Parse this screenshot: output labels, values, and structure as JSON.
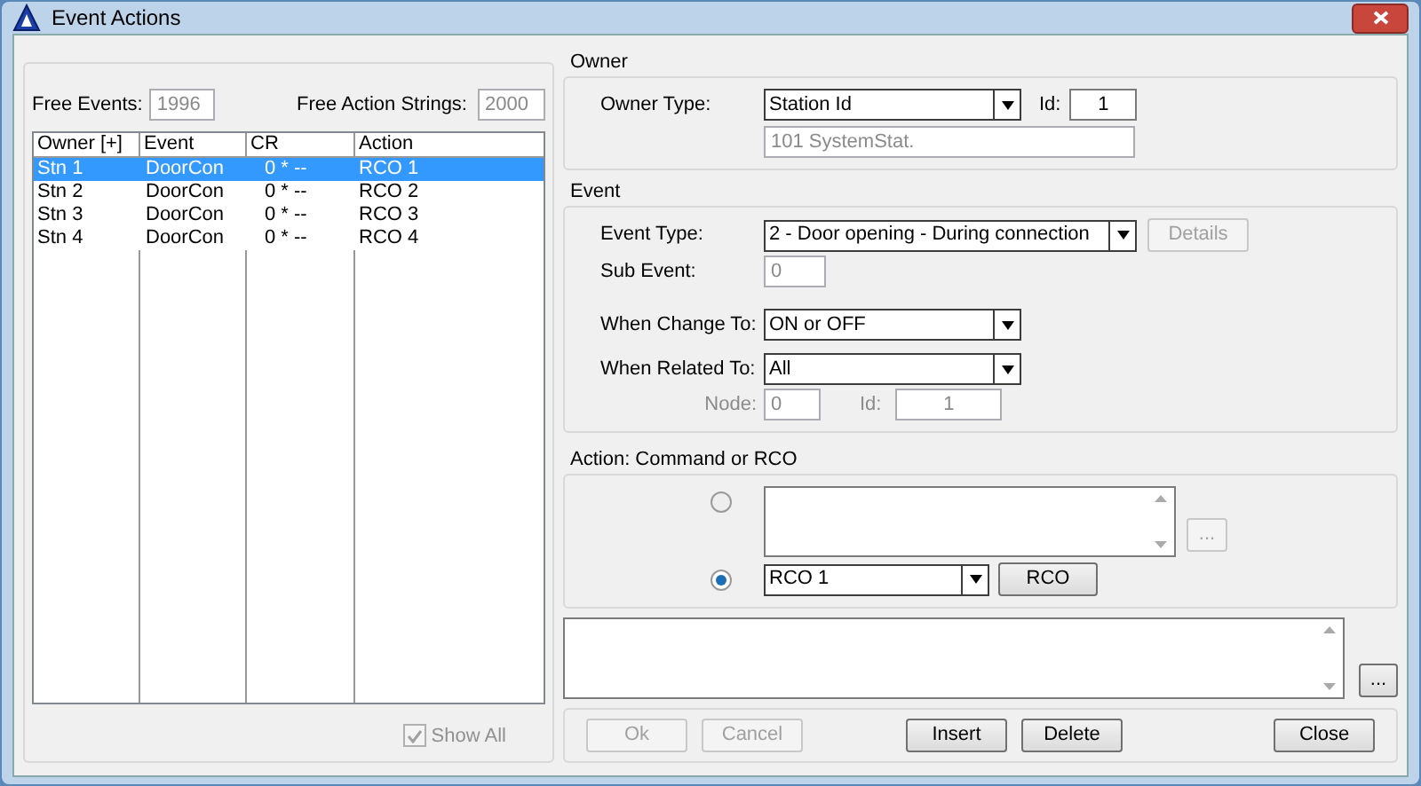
{
  "window": {
    "title": "Event Actions"
  },
  "events_panel": {
    "free_events_label": "Free Events:",
    "free_events_value": "1996",
    "free_strings_label": "Free Action Strings:",
    "free_strings_value": "2000",
    "columns": [
      "Owner [+]",
      "Event",
      "CR",
      "Action"
    ],
    "rows": [
      {
        "cells": [
          "Stn 1",
          "DoorCon",
          "0 * --",
          "RCO 1"
        ],
        "selected": true
      },
      {
        "cells": [
          "Stn 2",
          "DoorCon",
          "0 * --",
          "RCO 2"
        ],
        "selected": false
      },
      {
        "cells": [
          "Stn 3",
          "DoorCon",
          "0 * --",
          "RCO 3"
        ],
        "selected": false
      },
      {
        "cells": [
          "Stn 4",
          "DoorCon",
          "0 * --",
          "RCO 4"
        ],
        "selected": false
      }
    ],
    "show_all": {
      "label": "Show All",
      "checked": true,
      "disabled": true
    }
  },
  "owner": {
    "title": "Owner",
    "type_label": "Owner Type:",
    "type_value": "Station Id",
    "id_label": "Id:",
    "id_value": "1",
    "name_value": "101 SystemStat."
  },
  "event": {
    "title": "Event",
    "type_label": "Event Type:",
    "type_value": "2 - Door opening - During connection",
    "details": {
      "label": "Details",
      "disabled": true
    },
    "sub_label": "Sub Event:",
    "sub_value": "0",
    "change_label": "When Change To:",
    "change_value": "ON or OFF",
    "related_label": "When Related To:",
    "related_value": "All",
    "node_label": "Node:",
    "node_value": "0",
    "id_label": "Id:",
    "id_value": "1"
  },
  "action": {
    "title": "Action: Command or RCO",
    "options": [
      {
        "kind": "text",
        "selected": false,
        "more": {
          "label": "...",
          "disabled": true
        }
      },
      {
        "kind": "rco",
        "selected": true,
        "value": "RCO 1",
        "button": "RCO"
      }
    ]
  },
  "text_more": {
    "label": "...",
    "disabled": false
  },
  "footer": {
    "left": [
      {
        "label": "Ok",
        "disabled": true
      },
      {
        "label": "Cancel",
        "disabled": true
      }
    ],
    "middle": [
      {
        "label": "Insert",
        "disabled": false
      },
      {
        "label": "Delete",
        "disabled": false
      }
    ],
    "right": [
      {
        "label": "Close",
        "disabled": false
      }
    ]
  }
}
